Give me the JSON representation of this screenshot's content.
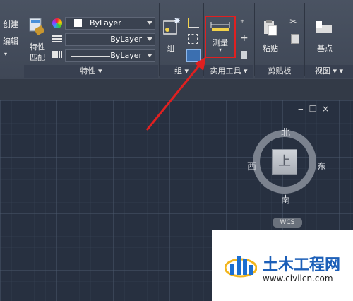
{
  "ribbon": {
    "modify_panel": {
      "create_label": "创建",
      "edit_label": "编辑"
    },
    "properties_panel": {
      "title": "特性",
      "match_label_line1": "特性",
      "match_label_line2": "匹配",
      "color_dropdown": "ByLayer",
      "linetype_dropdown": "ByLayer",
      "lineweight_dropdown": "ByLayer"
    },
    "groups_panel": {
      "title": "组",
      "group_label": "组"
    },
    "utilities_panel": {
      "title": "实用工具",
      "measure_label": "测量"
    },
    "clipboard_panel": {
      "title": "剪贴板",
      "paste_label": "粘贴"
    },
    "view_panel": {
      "title": "视图",
      "basepoint_label": "基点"
    }
  },
  "viewcube": {
    "top_label": "上",
    "north": "北",
    "south": "南",
    "east": "东",
    "west": "西",
    "wcs_label": "WCS"
  },
  "window_controls": {
    "minimize": "‒",
    "restore": "❐",
    "close": "×"
  },
  "watermark": {
    "brand": "土木工程网",
    "url": "www.civilcn.com"
  },
  "colors": {
    "accent_highlight": "#e02020",
    "canvas_bg": "#273040",
    "ribbon_bg": "#444c5a"
  }
}
